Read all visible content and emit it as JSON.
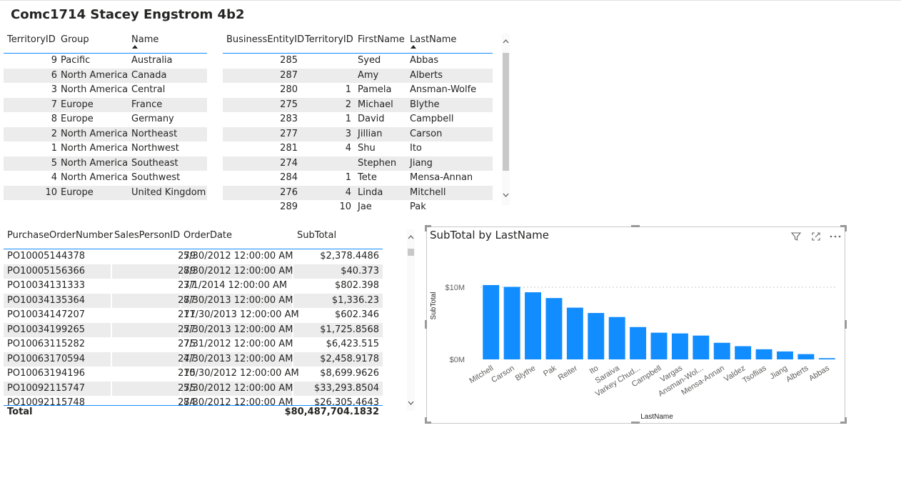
{
  "page_title": "Comc1714 Stacey Engstrom 4b2",
  "territory_table": {
    "headers": [
      "TerritoryID",
      "Group",
      "Name"
    ],
    "rows": [
      [
        "9",
        "Pacific",
        "Australia"
      ],
      [
        "6",
        "North America",
        "Canada"
      ],
      [
        "3",
        "North America",
        "Central"
      ],
      [
        "7",
        "Europe",
        "France"
      ],
      [
        "8",
        "Europe",
        "Germany"
      ],
      [
        "2",
        "North America",
        "Northeast"
      ],
      [
        "1",
        "North America",
        "Northwest"
      ],
      [
        "5",
        "North America",
        "Southeast"
      ],
      [
        "4",
        "North America",
        "Southwest"
      ],
      [
        "10",
        "Europe",
        "United Kingdom"
      ]
    ]
  },
  "person_table": {
    "headers": [
      "BusinessEntityID",
      "TerritoryID",
      "FirstName",
      "LastName"
    ],
    "rows": [
      [
        "285",
        "",
        "Syed",
        "Abbas"
      ],
      [
        "287",
        "",
        "Amy",
        "Alberts"
      ],
      [
        "280",
        "1",
        "Pamela",
        "Ansman-Wolfe"
      ],
      [
        "275",
        "2",
        "Michael",
        "Blythe"
      ],
      [
        "283",
        "1",
        "David",
        "Campbell"
      ],
      [
        "277",
        "3",
        "Jillian",
        "Carson"
      ],
      [
        "281",
        "4",
        "Shu",
        "Ito"
      ],
      [
        "274",
        "",
        "Stephen",
        "Jiang"
      ],
      [
        "284",
        "1",
        "Tete",
        "Mensa-Annan"
      ],
      [
        "276",
        "4",
        "Linda",
        "Mitchell"
      ],
      [
        "289",
        "10",
        "Jae",
        "Pak"
      ]
    ]
  },
  "orders_table": {
    "headers": [
      "PurchaseOrderNumber",
      "SalesPersonID",
      "OrderDate",
      "SubTotal"
    ],
    "rows": [
      [
        "PO10005144378",
        "279",
        "5/30/2012 12:00:00 AM",
        "$2,378.4486"
      ],
      [
        "PO10005156366",
        "279",
        "8/30/2012 12:00:00 AM",
        "$40.373"
      ],
      [
        "PO10034131333",
        "277",
        "3/1/2014 12:00:00 AM",
        "$802.398"
      ],
      [
        "PO10034135364",
        "277",
        "8/30/2013 12:00:00 AM",
        "$1,336.23"
      ],
      [
        "PO10034147207",
        "277",
        "11/30/2013 12:00:00 AM",
        "$602.346"
      ],
      [
        "PO10034199265",
        "277",
        "5/30/2013 12:00:00 AM",
        "$1,725.8568"
      ],
      [
        "PO10063115282",
        "275",
        "7/31/2012 12:00:00 AM",
        "$6,423.515"
      ],
      [
        "PO10063170594",
        "277",
        "4/30/2013 12:00:00 AM",
        "$2,458.9178"
      ],
      [
        "PO10063194196",
        "275",
        "10/30/2012 12:00:00 AM",
        "$8,699.9626"
      ],
      [
        "PO10092115747",
        "275",
        "5/30/2012 12:00:00 AM",
        "$33,293.8504"
      ],
      [
        "PO10092115748",
        "274",
        "8/30/2012 12:00:00 AM",
        "$26,305.4643"
      ]
    ],
    "total_label": "Total",
    "total_value": "$80,487,704.1832"
  },
  "icons": {
    "filter": "filter-icon",
    "focus": "focus-mode-icon",
    "more": "more-options-icon",
    "scroll_up": "chevron-up-icon",
    "scroll_down": "chevron-down-icon"
  },
  "colors": {
    "accent": "#118dff",
    "bar": "#118dff",
    "row_alt": "#ececec"
  },
  "chart_data": {
    "type": "bar",
    "title": "SubTotal by LastName",
    "xlabel": "LastName",
    "ylabel": "SubTotal",
    "yticks": [
      "$0M",
      "$10M"
    ],
    "ylim": [
      0,
      12000000
    ],
    "categories": [
      "Mitchell",
      "Carson",
      "Blythe",
      "Pak",
      "Reiter",
      "Ito",
      "Saraiva",
      "Varkey Chud...",
      "Campbell",
      "Vargas",
      "Ansman-Wol...",
      "Mensa-Annan",
      "Valdez",
      "Tsoflias",
      "Jiang",
      "Alberts",
      "Abbas"
    ],
    "values": [
      10300000,
      10050000,
      9300000,
      8500000,
      7170000,
      6430000,
      5870000,
      4480000,
      3700000,
      3600000,
      3300000,
      2300000,
      1830000,
      1400000,
      1100000,
      730000,
      170000
    ],
    "grid": true,
    "legend": "none"
  }
}
